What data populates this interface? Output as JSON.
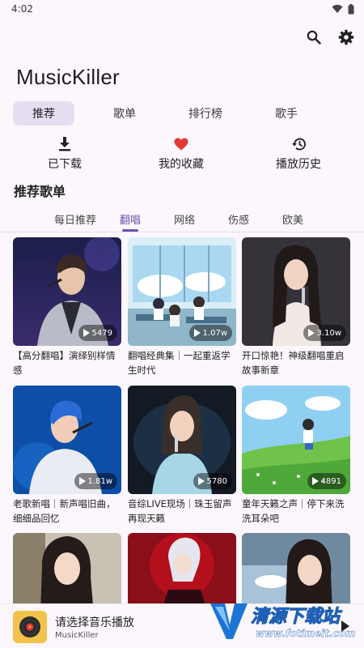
{
  "status": {
    "time": "4:02"
  },
  "header": {
    "title": "MusicKiller"
  },
  "main_tabs": [
    {
      "label": "推荐",
      "active": true
    },
    {
      "label": "歌单",
      "active": false
    },
    {
      "label": "排行榜",
      "active": false
    },
    {
      "label": "歌手",
      "active": false
    }
  ],
  "quick_actions": [
    {
      "label": "已下载",
      "icon": "download-icon"
    },
    {
      "label": "我的收藏",
      "icon": "heart-icon"
    },
    {
      "label": "播放历史",
      "icon": "history-icon"
    }
  ],
  "section": {
    "title": "推荐歌单"
  },
  "sub_tabs": [
    {
      "label": "每日推荐",
      "active": false
    },
    {
      "label": "翻唱",
      "active": true
    },
    {
      "label": "网络",
      "active": false
    },
    {
      "label": "伤感",
      "active": false
    },
    {
      "label": "欧美",
      "active": false
    }
  ],
  "playlists": [
    {
      "title": "【高分翻唱】演绎别样情感",
      "plays": "5479"
    },
    {
      "title": "翻唱经典集｜一起重返学生时代",
      "plays": "1.07w"
    },
    {
      "title": "开口惊艳！神级翻唱重启故事新章",
      "plays": "3.10w"
    },
    {
      "title": "老歌新唱｜新声唱旧曲，细细品回忆",
      "plays": "1.81w"
    },
    {
      "title": "音综LIVE现场｜珠玉留声再现天籁",
      "plays": "5780"
    },
    {
      "title": "童年天籁之声｜停下来洗洗耳朵吧",
      "plays": "4891"
    },
    {
      "title": "",
      "plays": ""
    },
    {
      "title": "",
      "plays": ""
    },
    {
      "title": "",
      "plays": ""
    }
  ],
  "mini_player": {
    "title": "请选择音乐播放",
    "subtitle": "MusicKiller"
  },
  "watermark": {
    "text": "清源下载站",
    "url": "www.fotimeit.com"
  },
  "colors": {
    "accent": "#6b54a8",
    "tab_active_bg": "#e6def0",
    "heart": "#e53935",
    "background": "#fbf7fc"
  }
}
